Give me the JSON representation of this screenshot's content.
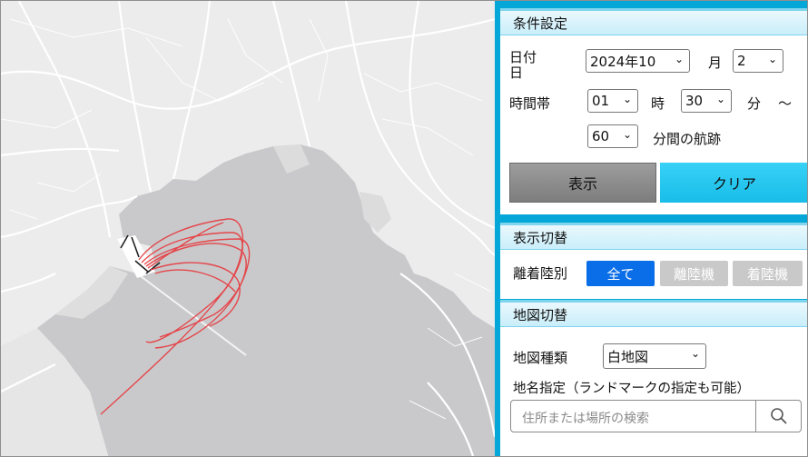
{
  "conditions": {
    "header": "条件設定",
    "date_label_line1": "日付",
    "date_label_line2": "日",
    "year_month_value": "2024年10",
    "month_label": "月",
    "day_value": "2",
    "time_label": "時間帯",
    "hour_value": "01",
    "hour_unit": "時",
    "minute_value": "30",
    "minute_unit": "分",
    "tilde": "～",
    "duration_value": "60",
    "duration_suffix": "分間の航跡",
    "show_button": "表示",
    "clear_button": "クリア"
  },
  "display_toggle": {
    "header": "表示切替",
    "label": "離着陸別",
    "options": [
      "全て",
      "離陸機",
      "着陸機"
    ],
    "selected": "全て"
  },
  "map_toggle": {
    "header": "地図切替",
    "type_label": "地図種類",
    "type_value": "白地図",
    "place_label": "地名指定（ランドマークの指定も可能）",
    "search_placeholder": "住所または場所の検索"
  },
  "colors": {
    "panel_blue": "#04a7d8",
    "active_blue": "#0a6ee8",
    "track_red": "#e8383d"
  },
  "icons": [
    "chevron-down-icon",
    "search-icon"
  ]
}
